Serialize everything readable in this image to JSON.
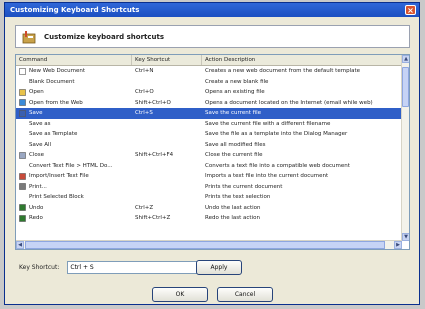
{
  "window": {
    "title": "Customizing Keyboard Shortcuts",
    "close_glyph": "×"
  },
  "banner": {
    "text": "Customize keyboard shortcuts",
    "icon": "keyboard-shortcut-icon"
  },
  "table": {
    "headers": [
      "Command",
      "Key Shortcut",
      "Action Description"
    ],
    "rows": [
      {
        "command": "New Web Document",
        "key": "Ctrl+N",
        "desc": "Creates a new web document from the default template",
        "icon": "new-doc-icon",
        "indent": false,
        "selected": false
      },
      {
        "command": "Blank Document",
        "key": "",
        "desc": "Create a new blank file",
        "icon": "",
        "indent": true,
        "selected": false
      },
      {
        "command": "Open",
        "key": "Ctrl+O",
        "desc": "Opens an existing file",
        "icon": "open-folder-icon",
        "indent": false,
        "selected": false
      },
      {
        "command": "Open from the Web",
        "key": "Shift+Ctrl+O",
        "desc": "Opens a document located on the Internet (email while web)",
        "icon": "globe-icon",
        "indent": false,
        "selected": false
      },
      {
        "command": "Save",
        "key": "Ctrl+S",
        "desc": "Save the current file",
        "icon": "save-disk-icon",
        "indent": false,
        "selected": true
      },
      {
        "command": "Save as",
        "key": "",
        "desc": "Save the current file with a different filename",
        "icon": "",
        "indent": true,
        "selected": false
      },
      {
        "command": "Save as Template",
        "key": "",
        "desc": "Save the file as a template into the Dialog Manager",
        "icon": "",
        "indent": true,
        "selected": false
      },
      {
        "command": "Save All",
        "key": "",
        "desc": "Save all modified files",
        "icon": "",
        "indent": true,
        "selected": false
      },
      {
        "command": "Close",
        "key": "Shift+Ctrl+F4",
        "desc": "Close the current file",
        "icon": "close-file-icon",
        "indent": false,
        "selected": false
      },
      {
        "command": "Convert Text File > HTML Do...",
        "key": "",
        "desc": "Converts a text file into a compatible web document",
        "icon": "",
        "indent": true,
        "selected": false
      },
      {
        "command": "Import/Insert Text File",
        "key": "",
        "desc": "Imports a text file into the current document",
        "icon": "import-icon",
        "indent": false,
        "selected": false
      },
      {
        "command": "Print...",
        "key": "",
        "desc": "Prints the current document",
        "icon": "printer-icon",
        "indent": false,
        "selected": false
      },
      {
        "command": "Print Selected Block",
        "key": "",
        "desc": "Prints the text selection",
        "icon": "",
        "indent": true,
        "selected": false
      },
      {
        "command": "Undo",
        "key": "Ctrl+Z",
        "desc": "Undo the last action",
        "icon": "undo-icon",
        "indent": false,
        "selected": false
      },
      {
        "command": "Redo",
        "key": "Shift+Ctrl+Z",
        "desc": "Redo the last action",
        "icon": "redo-icon",
        "indent": false,
        "selected": false
      }
    ]
  },
  "key_shortcut": {
    "label": "Key Shortcut:",
    "value": "Ctrl + S"
  },
  "buttons": {
    "apply": "Apply",
    "ok": "OK",
    "cancel": "Cancel"
  },
  "scroll": {
    "up": "▲",
    "down": "▼",
    "left": "◀",
    "right": "▶"
  },
  "colors": {
    "selection": "#2f5fc8",
    "titlebar": "#1c4fc1"
  }
}
